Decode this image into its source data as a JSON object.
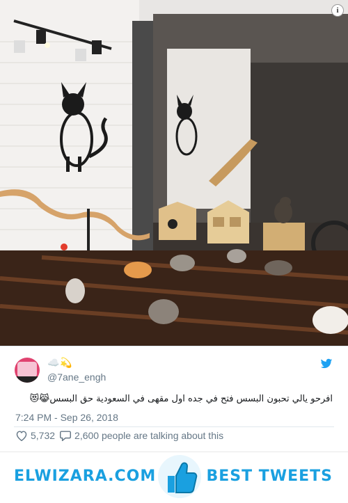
{
  "photo": {
    "info_icon": "i"
  },
  "tweet": {
    "user_emoji": "☁️💫",
    "handle": "@7ane_engh",
    "text": "افرحو يالي تحبون البسس فتح في جده اول مقهى في السعودية حق البسس😹😻",
    "timestamp": "7:24 PM - Sep 26, 2018",
    "likes": "5,732",
    "replies_text": "2,600 people are talking about this"
  },
  "footer": {
    "brand": "ELWIZARA.COM",
    "tagline": "BEST TWEETS"
  },
  "colors": {
    "twitter_blue": "#1da1f2",
    "brand_blue": "#1aa0e0",
    "muted_text": "#657786"
  }
}
